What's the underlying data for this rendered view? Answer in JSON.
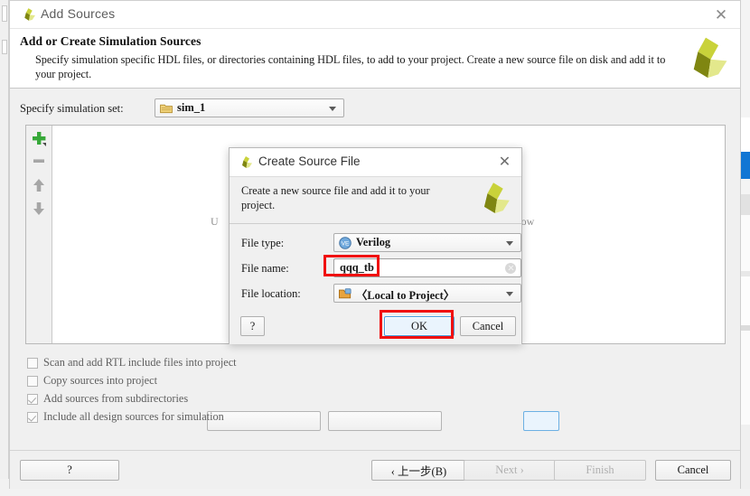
{
  "window": {
    "title": "Add Sources",
    "close_label": "✕",
    "logo_icon": "vivado-logo-icon"
  },
  "banner": {
    "heading": "Add or Create Simulation Sources",
    "description": "Specify simulation specific HDL files, or directories containing HDL files, to add to your project. Create a new source file on disk and add it to your project.",
    "logo_icon": "xilinx-logo-icon"
  },
  "simset": {
    "label": "Specify simulation set:",
    "value": "sim_1",
    "icon": "folder-icon",
    "arrow_icon": "chevron-down-icon"
  },
  "toolbar": {
    "add_icon": "plus-icon",
    "remove_icon": "minus-icon",
    "move_up_icon": "arrow-up-icon",
    "move_down_icon": "arrow-down-icon"
  },
  "panel": {
    "hint_partial_left": "U",
    "hint_partial_right": "below"
  },
  "checkboxes": [
    {
      "label": "Scan and add RTL include files into project",
      "checked": false
    },
    {
      "label": "Copy sources into project",
      "checked": false
    },
    {
      "label": "Add sources from subdirectories",
      "checked": true
    },
    {
      "label": "Include all design sources for simulation",
      "checked": true
    }
  ],
  "footer": {
    "help_label": "?",
    "back_label": "‹ 上一步(B)",
    "next_label": "Next ›",
    "finish_label": "Finish",
    "cancel_label": "Cancel",
    "next_enabled": false,
    "finish_enabled": false
  },
  "dialog": {
    "title": "Create Source File",
    "close_label": "✕",
    "logo_icon": "vivado-logo-icon",
    "description": "Create a new source file and add it to your project.",
    "banner_logo_icon": "xilinx-logo-icon",
    "fields": {
      "file_type": {
        "label": "File type:",
        "value": "Verilog",
        "icon": "verilog-file-icon",
        "arrow_icon": "chevron-down-icon"
      },
      "file_name": {
        "label": "File name:",
        "value": "qqq_tb",
        "placeholder": "",
        "clear_icon": "clear-icon"
      },
      "file_location": {
        "label": "File location:",
        "value": "〈Local to Project〉",
        "icon": "folder-open-icon",
        "arrow_icon": "chevron-down-icon"
      }
    },
    "buttons": {
      "help_label": "?",
      "ok_label": "OK",
      "cancel_label": "Cancel"
    }
  },
  "annotations": {
    "highlight_color": "#f01010",
    "boxes": [
      "file-name-field",
      "ok-button"
    ]
  }
}
